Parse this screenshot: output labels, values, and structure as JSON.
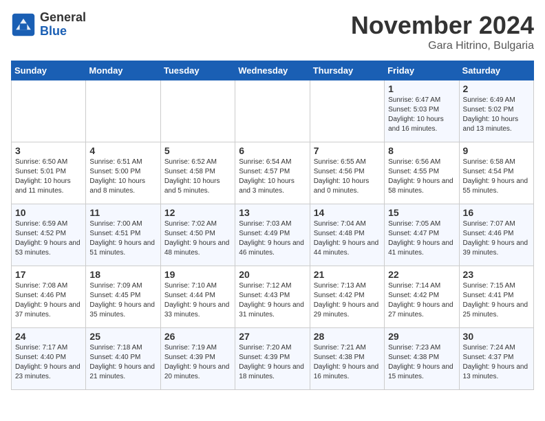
{
  "header": {
    "logo_general": "General",
    "logo_blue": "Blue",
    "month_title": "November 2024",
    "location": "Gara Hitrino, Bulgaria"
  },
  "days_of_week": [
    "Sunday",
    "Monday",
    "Tuesday",
    "Wednesday",
    "Thursday",
    "Friday",
    "Saturday"
  ],
  "weeks": [
    [
      {
        "day": "",
        "info": ""
      },
      {
        "day": "",
        "info": ""
      },
      {
        "day": "",
        "info": ""
      },
      {
        "day": "",
        "info": ""
      },
      {
        "day": "",
        "info": ""
      },
      {
        "day": "1",
        "info": "Sunrise: 6:47 AM\nSunset: 5:03 PM\nDaylight: 10 hours and 16 minutes."
      },
      {
        "day": "2",
        "info": "Sunrise: 6:49 AM\nSunset: 5:02 PM\nDaylight: 10 hours and 13 minutes."
      }
    ],
    [
      {
        "day": "3",
        "info": "Sunrise: 6:50 AM\nSunset: 5:01 PM\nDaylight: 10 hours and 11 minutes."
      },
      {
        "day": "4",
        "info": "Sunrise: 6:51 AM\nSunset: 5:00 PM\nDaylight: 10 hours and 8 minutes."
      },
      {
        "day": "5",
        "info": "Sunrise: 6:52 AM\nSunset: 4:58 PM\nDaylight: 10 hours and 5 minutes."
      },
      {
        "day": "6",
        "info": "Sunrise: 6:54 AM\nSunset: 4:57 PM\nDaylight: 10 hours and 3 minutes."
      },
      {
        "day": "7",
        "info": "Sunrise: 6:55 AM\nSunset: 4:56 PM\nDaylight: 10 hours and 0 minutes."
      },
      {
        "day": "8",
        "info": "Sunrise: 6:56 AM\nSunset: 4:55 PM\nDaylight: 9 hours and 58 minutes."
      },
      {
        "day": "9",
        "info": "Sunrise: 6:58 AM\nSunset: 4:54 PM\nDaylight: 9 hours and 55 minutes."
      }
    ],
    [
      {
        "day": "10",
        "info": "Sunrise: 6:59 AM\nSunset: 4:52 PM\nDaylight: 9 hours and 53 minutes."
      },
      {
        "day": "11",
        "info": "Sunrise: 7:00 AM\nSunset: 4:51 PM\nDaylight: 9 hours and 51 minutes."
      },
      {
        "day": "12",
        "info": "Sunrise: 7:02 AM\nSunset: 4:50 PM\nDaylight: 9 hours and 48 minutes."
      },
      {
        "day": "13",
        "info": "Sunrise: 7:03 AM\nSunset: 4:49 PM\nDaylight: 9 hours and 46 minutes."
      },
      {
        "day": "14",
        "info": "Sunrise: 7:04 AM\nSunset: 4:48 PM\nDaylight: 9 hours and 44 minutes."
      },
      {
        "day": "15",
        "info": "Sunrise: 7:05 AM\nSunset: 4:47 PM\nDaylight: 9 hours and 41 minutes."
      },
      {
        "day": "16",
        "info": "Sunrise: 7:07 AM\nSunset: 4:46 PM\nDaylight: 9 hours and 39 minutes."
      }
    ],
    [
      {
        "day": "17",
        "info": "Sunrise: 7:08 AM\nSunset: 4:46 PM\nDaylight: 9 hours and 37 minutes."
      },
      {
        "day": "18",
        "info": "Sunrise: 7:09 AM\nSunset: 4:45 PM\nDaylight: 9 hours and 35 minutes."
      },
      {
        "day": "19",
        "info": "Sunrise: 7:10 AM\nSunset: 4:44 PM\nDaylight: 9 hours and 33 minutes."
      },
      {
        "day": "20",
        "info": "Sunrise: 7:12 AM\nSunset: 4:43 PM\nDaylight: 9 hours and 31 minutes."
      },
      {
        "day": "21",
        "info": "Sunrise: 7:13 AM\nSunset: 4:42 PM\nDaylight: 9 hours and 29 minutes."
      },
      {
        "day": "22",
        "info": "Sunrise: 7:14 AM\nSunset: 4:42 PM\nDaylight: 9 hours and 27 minutes."
      },
      {
        "day": "23",
        "info": "Sunrise: 7:15 AM\nSunset: 4:41 PM\nDaylight: 9 hours and 25 minutes."
      }
    ],
    [
      {
        "day": "24",
        "info": "Sunrise: 7:17 AM\nSunset: 4:40 PM\nDaylight: 9 hours and 23 minutes."
      },
      {
        "day": "25",
        "info": "Sunrise: 7:18 AM\nSunset: 4:40 PM\nDaylight: 9 hours and 21 minutes."
      },
      {
        "day": "26",
        "info": "Sunrise: 7:19 AM\nSunset: 4:39 PM\nDaylight: 9 hours and 20 minutes."
      },
      {
        "day": "27",
        "info": "Sunrise: 7:20 AM\nSunset: 4:39 PM\nDaylight: 9 hours and 18 minutes."
      },
      {
        "day": "28",
        "info": "Sunrise: 7:21 AM\nSunset: 4:38 PM\nDaylight: 9 hours and 16 minutes."
      },
      {
        "day": "29",
        "info": "Sunrise: 7:23 AM\nSunset: 4:38 PM\nDaylight: 9 hours and 15 minutes."
      },
      {
        "day": "30",
        "info": "Sunrise: 7:24 AM\nSunset: 4:37 PM\nDaylight: 9 hours and 13 minutes."
      }
    ]
  ]
}
